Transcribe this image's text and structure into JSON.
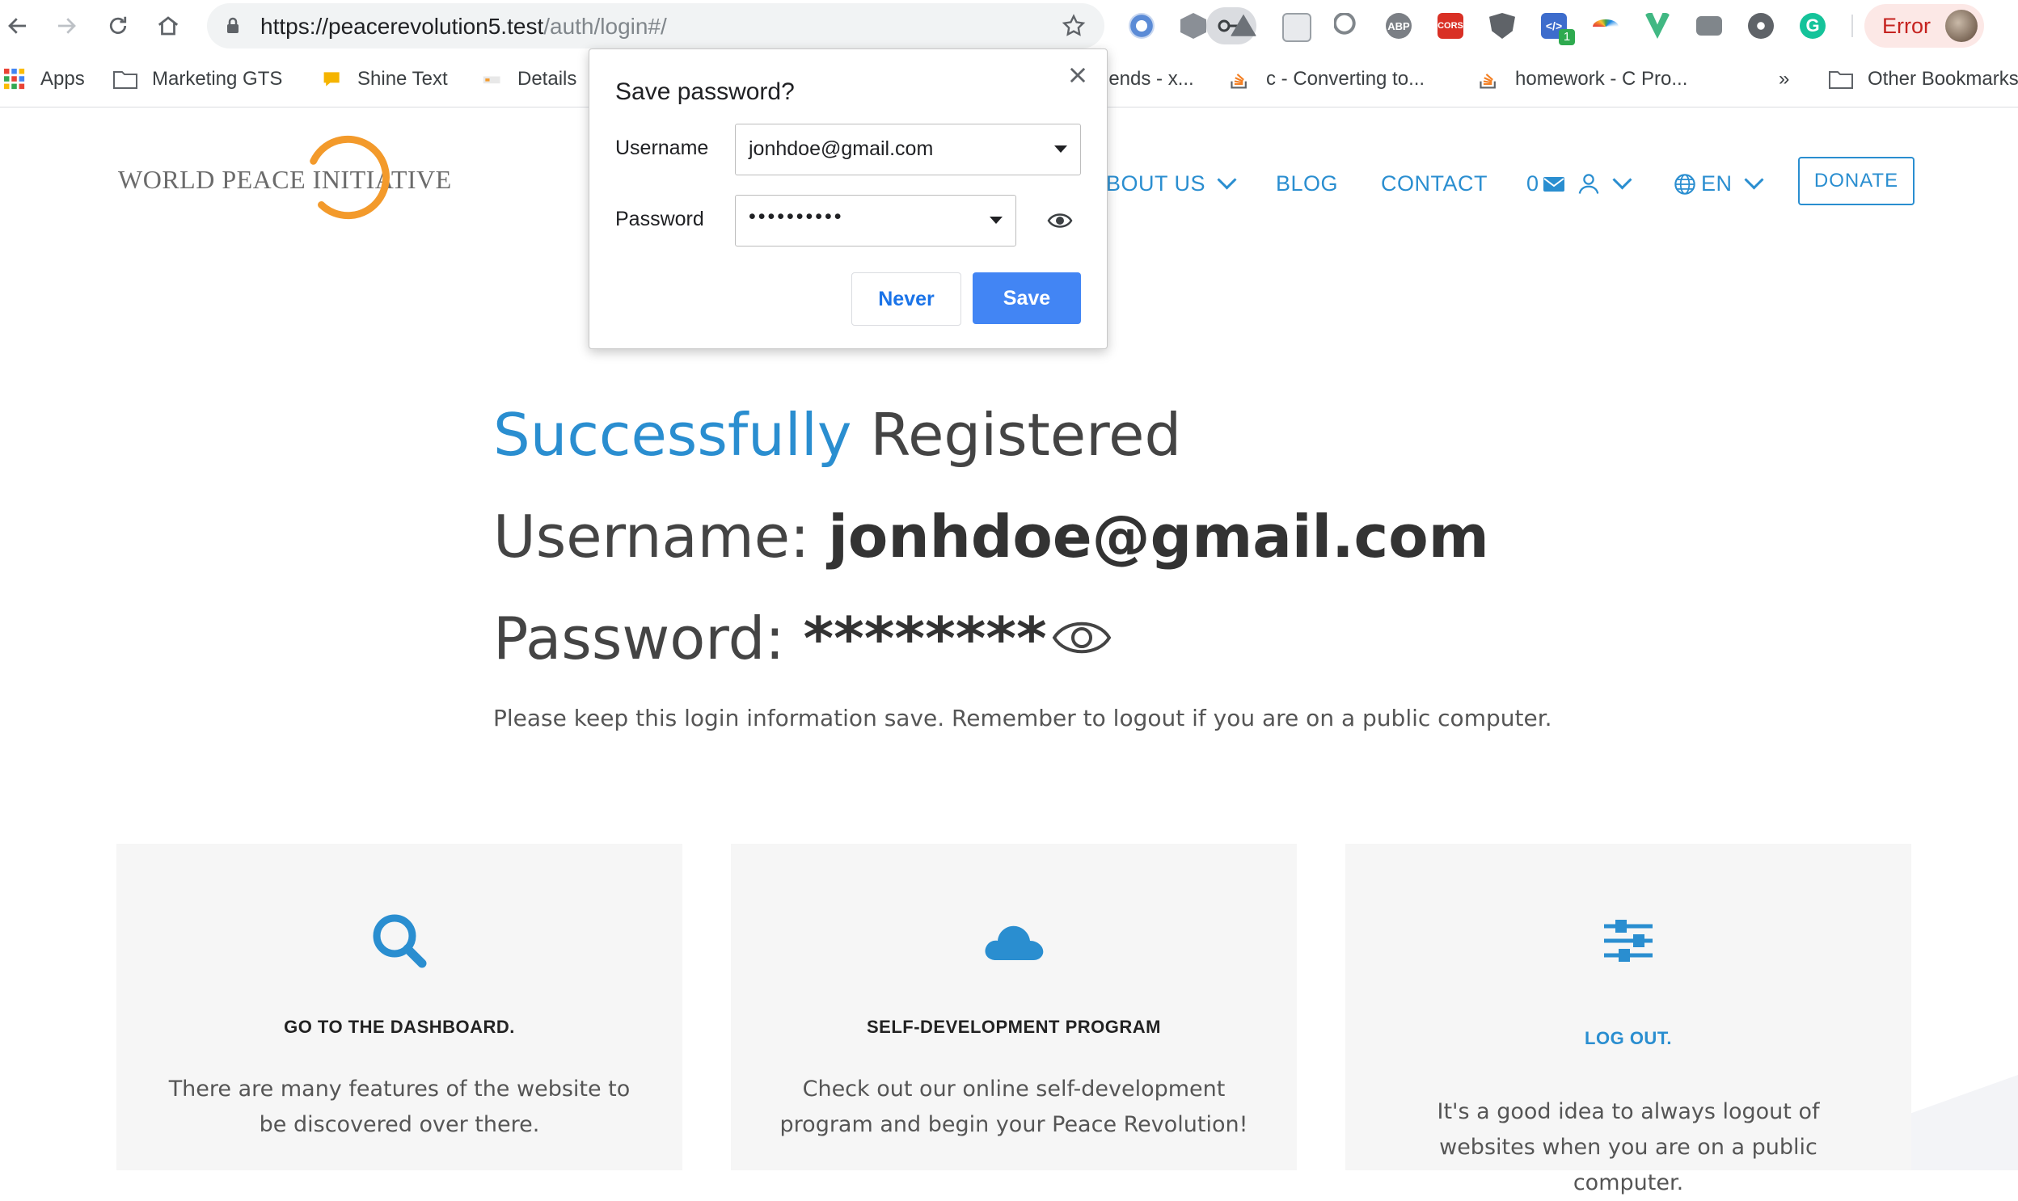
{
  "browser": {
    "url_host": "https://peacerevolution5.test",
    "url_path": "/auth/login#/",
    "error_label": "Error"
  },
  "bookmarks": {
    "apps": "Apps",
    "marketing": "Marketing GTS",
    "shine": "Shine Text",
    "details": "Details",
    "friends": "iends - x...",
    "converting": "c - Converting to...",
    "homework": "homework - C Pro...",
    "overflow": "»",
    "other": "Other Bookmarks"
  },
  "extensions": {
    "badge_count": "1",
    "icons": [
      "opera-icon",
      "cube-icon",
      "drive-icon",
      "notes-icon",
      "magnifier-icon",
      "adblock-icon",
      "cors-icon",
      "ublock-icon",
      "code-icon",
      "rainbow-icon",
      "vue-icon",
      "camera-icon",
      "film-icon",
      "grammarly-icon"
    ]
  },
  "site": {
    "logo_text": "WORLD PEACE INITIATIVE",
    "nav": {
      "about": "BOUT US",
      "blog": "BLOG",
      "contact": "CONTACT",
      "mail_count": "0",
      "lang": "EN",
      "donate": "DONATE"
    },
    "headline_blue": "Successfully",
    "headline_rest": " Registered",
    "username_label": "Username: ",
    "username_value": "jonhdoe@gmail.com",
    "password_label": "Password: ",
    "password_value": "********",
    "note": "Please keep this login information save. Remember to logout if you are on a public computer.",
    "cards": [
      {
        "title": "GO TO THE DASHBOARD.",
        "text": "There are many features of the website to be discovered over there.",
        "icon": "search-icon"
      },
      {
        "title": "SELF-DEVELOPMENT PROGRAM",
        "text": "Check out our online self-development program and begin your Peace Revolution!",
        "icon": "cloud-icon"
      },
      {
        "title": "LOG OUT.",
        "text": "It's a good idea to always logout of websites when you are on a public computer.",
        "icon": "sliders-icon"
      }
    ]
  },
  "save_dialog": {
    "title": "Save password?",
    "username_label": "Username",
    "username_value": "jonhdoe@gmail.com",
    "password_label": "Password",
    "password_value": "••••••••••",
    "never_label": "Never",
    "save_label": "Save"
  },
  "colors": {
    "accent": "#2a8ed0",
    "chrome_blue": "#4285f4",
    "logo_orange": "#f39a2b",
    "card_bg": "#f6f6f6"
  }
}
